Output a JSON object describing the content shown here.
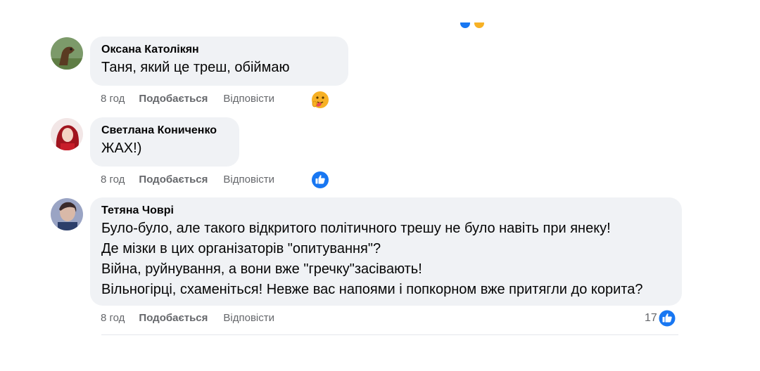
{
  "comments": [
    {
      "author": "Оксана Католікян",
      "lines": [
        "Таня, який це треш, обіймаю"
      ],
      "time": "8 год",
      "like_label": "Подобається",
      "reply_label": "Відповісти",
      "reaction_icon": "care-emoji-icon"
    },
    {
      "author": "Светлана Коничен­ко",
      "lines": [
        "ЖАХ!)"
      ],
      "time": "8 год",
      "like_label": "Подобається",
      "reply_label": "Відповісти",
      "reaction_icon": "like-thumb-icon"
    },
    {
      "author": "Тетяна Човрі",
      "lines": [
        "Було-було, але такого відкритого політичного трешу не було навіть при янеку!",
        "Де мізки в цих організаторів \"опитування\"?",
        "Війна, руйнування, а вони вже \"гречку\"засівають!",
        "Вільногірці, схаменіться! Невже вас напоями і попкорном вже притягли до корита?"
      ],
      "time": "8 год",
      "like_label": "Подобається",
      "reply_label": "Відповісти",
      "reaction_count": "17",
      "reaction_icon": "like-thumb-icon"
    }
  ],
  "colors": {
    "bubble": "#f0f2f5",
    "meta_text": "#65676b",
    "like_blue": "#1877f2",
    "care_yellow": "#f7b125"
  }
}
